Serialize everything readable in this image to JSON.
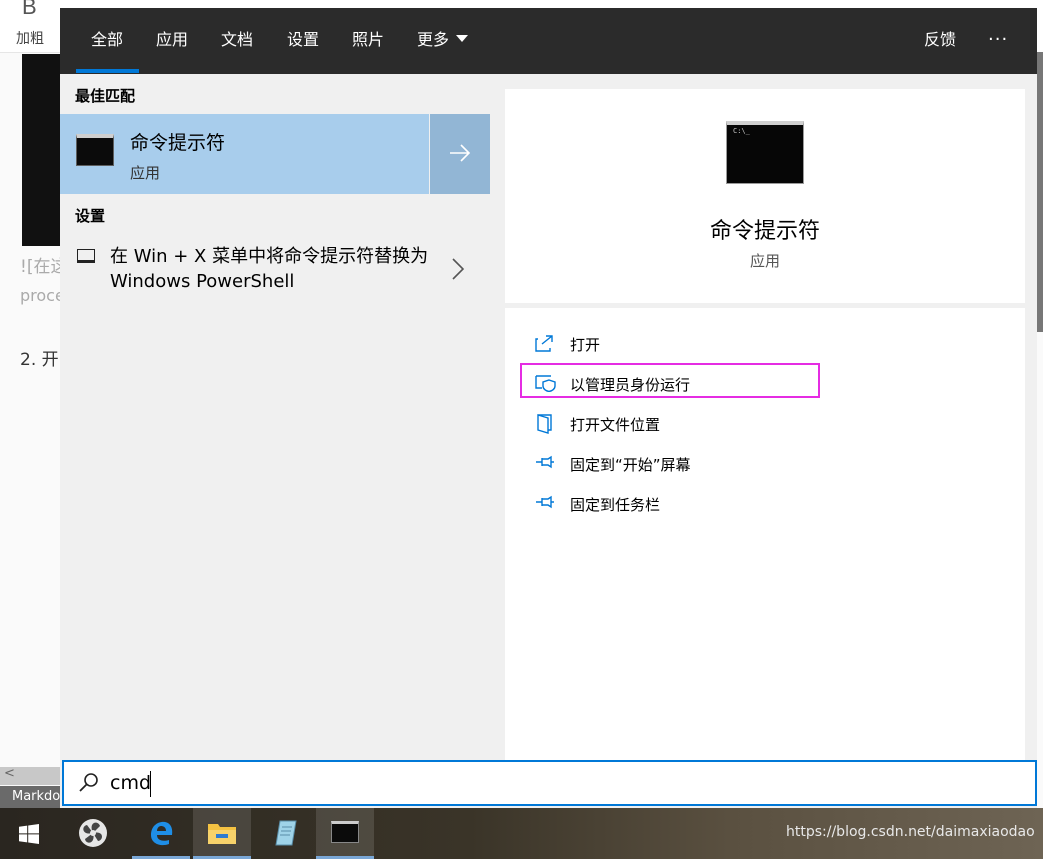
{
  "background": {
    "bold_glyph": "B",
    "bold_label": "加粗",
    "line1": "![在这",
    "line2": "proce",
    "line3": "2. 开",
    "scroll_arrow": "<",
    "status": "Markdo"
  },
  "tabs": [
    {
      "label": "全部",
      "active": true
    },
    {
      "label": "应用"
    },
    {
      "label": "文档"
    },
    {
      "label": "设置"
    },
    {
      "label": "照片"
    },
    {
      "label": "更多"
    }
  ],
  "feedback_label": "反馈",
  "more_options": "···",
  "best_match": {
    "section": "最佳匹配",
    "title": "命令提示符",
    "subtitle": "应用"
  },
  "settings": {
    "section": "设置",
    "item_text": "在 Win + X 菜单中将命令提示符替换为 Windows PowerShell"
  },
  "preview": {
    "icon_prompt": "C:\\_",
    "title": "命令提示符",
    "subtitle": "应用"
  },
  "actions": [
    {
      "label": "打开",
      "icon": "open-icon"
    },
    {
      "label": "以管理员身份运行",
      "icon": "shield-icon",
      "highlighted": true
    },
    {
      "label": "打开文件位置",
      "icon": "file-location-icon"
    },
    {
      "label": "固定到“开始”屏幕",
      "icon": "pin-icon"
    },
    {
      "label": "固定到任务栏",
      "icon": "pin-icon"
    }
  ],
  "search": {
    "value": "cmd"
  },
  "taskbar": {
    "items": [
      "windows-start",
      "fan-app",
      "edge",
      "file-explorer",
      "notepad",
      "cmd"
    ]
  },
  "watermark": "https://blog.csdn.net/daimaxiaodao",
  "colors": {
    "accent": "#0078d7",
    "selected_bg": "#a8cdec",
    "highlight_border": "#e52ce3"
  }
}
